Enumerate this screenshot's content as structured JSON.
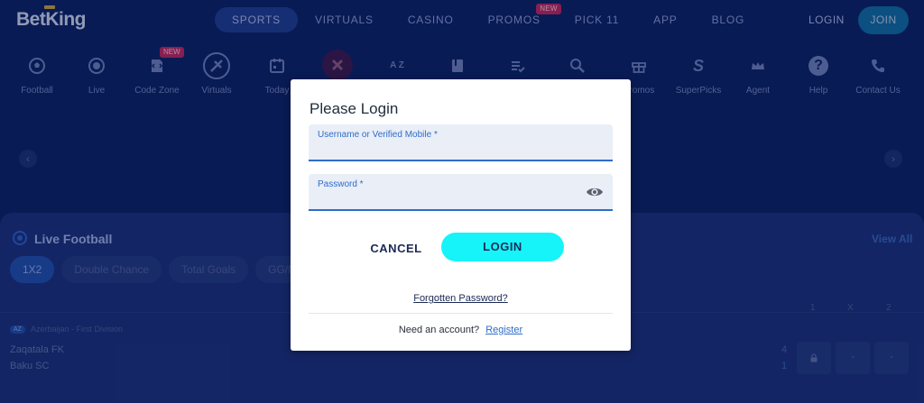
{
  "brand": {
    "logo_text": "BetKing"
  },
  "nav": {
    "items": [
      {
        "label": "SPORTS"
      },
      {
        "label": "VIRTUALS"
      },
      {
        "label": "CASINO"
      },
      {
        "label": "PROMOS",
        "badge": "NEW"
      },
      {
        "label": "PICK 11"
      },
      {
        "label": "APP"
      },
      {
        "label": "BLOG"
      }
    ],
    "active": "SPORTS",
    "login_label": "LOGIN",
    "join_label": "JOIN"
  },
  "categories": [
    {
      "label": "Football",
      "icon": "football-icon"
    },
    {
      "label": "Live",
      "icon": "live-icon"
    },
    {
      "label": "Code Zone",
      "icon": "code-zone-icon",
      "badge": "NEW"
    },
    {
      "label": "Virtuals",
      "icon": "virtuals-icon"
    },
    {
      "label": "Today",
      "icon": "calendar-icon"
    },
    {
      "label": "",
      "icon": "x-icon"
    },
    {
      "label": "",
      "icon": "az-icon"
    },
    {
      "label": "",
      "icon": "book-icon"
    },
    {
      "label": "",
      "icon": "list-check-icon"
    },
    {
      "label": "",
      "icon": "search-icon"
    },
    {
      "label": "Promos",
      "icon": "gift-icon"
    },
    {
      "label": "SuperPicks",
      "icon": "superpicks-icon"
    },
    {
      "label": "Agent",
      "icon": "crown-icon"
    },
    {
      "label": "Help",
      "icon": "help-icon"
    },
    {
      "label": "Contact Us",
      "icon": "phone-icon"
    }
  ],
  "live_football": {
    "title": "Live Football",
    "view_all": "View All",
    "market_tabs": [
      "1X2",
      "Double Chance",
      "Total Goals",
      "GG/N"
    ],
    "columns": [
      "1",
      "X",
      "2"
    ],
    "league_badge": "AZ",
    "league": "Azerbaijan - First Division",
    "match": {
      "home": "Zaqatala FK",
      "away": "Baku SC",
      "home_score": "4",
      "away_score": "1",
      "odds": [
        "",
        "-",
        "-"
      ]
    }
  },
  "login_modal": {
    "title": "Please Login",
    "username_label": "Username or Verified Mobile *",
    "username_value": "",
    "password_label": "Password *",
    "password_value": "",
    "cancel_label": "CANCEL",
    "login_label": "LOGIN",
    "forgot_label": "Forgotten Password?",
    "need_account_text": "Need an account?",
    "register_label": "Register"
  },
  "colors": {
    "background": "#0b2060",
    "panel": "#1b2f77",
    "login_button": "#16f4f9",
    "field_underline": "#2f6cc9",
    "badge": "#c0265a"
  }
}
